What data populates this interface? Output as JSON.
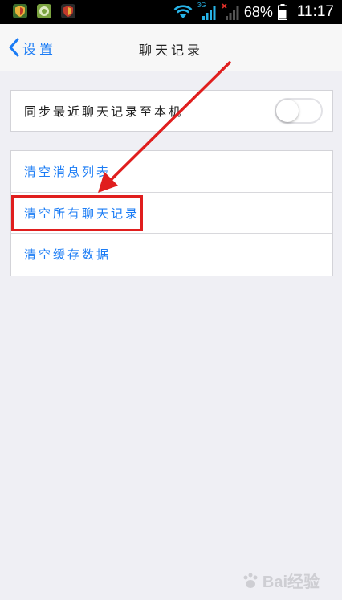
{
  "status_bar": {
    "app_icons": [
      "shield-icon",
      "android-icon",
      "shield-icon"
    ],
    "network": "3G",
    "battery_percent": "68%",
    "time": "11:17"
  },
  "nav": {
    "back_label": "设置",
    "title": "聊天记录"
  },
  "sync_section": {
    "label": "同步最近聊天记录至本机",
    "toggle_on": false
  },
  "clear_section": {
    "items": [
      {
        "label": "清空消息列表"
      },
      {
        "label": "清空所有聊天记录"
      },
      {
        "label": "清空缓存数据"
      }
    ]
  },
  "colors": {
    "accent": "#1b7cf5",
    "background": "#efeff4",
    "annotation": "#e01e1e"
  },
  "watermark": {
    "text": "Bai经验"
  }
}
